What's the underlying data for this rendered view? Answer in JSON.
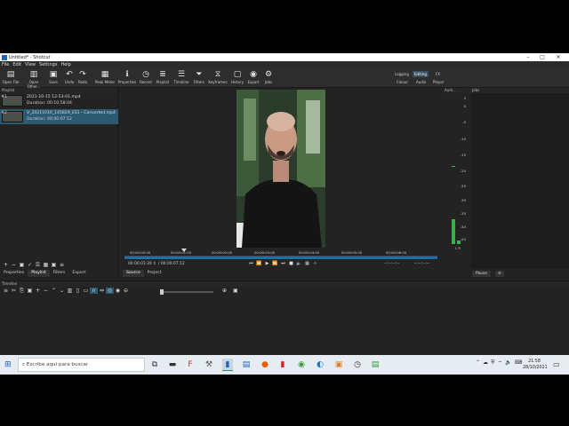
{
  "window": {
    "title": "Untitled* - Shotcut",
    "minimize": "–",
    "maximize": "□",
    "close": "✕"
  },
  "menu": [
    "File",
    "Edit",
    "View",
    "Settings",
    "Help"
  ],
  "toolbar": {
    "open_file": "Open File",
    "open_other": "Open Other...",
    "save": "Save",
    "undo": "Undo",
    "redo": "Redo",
    "peak_meter": "Peak Meter",
    "properties": "Properties",
    "recent": "Recent",
    "playlist": "Playlist",
    "timeline": "Timeline",
    "filters": "Filters",
    "keyframes": "Keyframes",
    "history": "History",
    "export": "Export",
    "jobs": "Jobs"
  },
  "layouts": {
    "logging": "Logging",
    "editing": "Editing",
    "fx": "FX",
    "colour": "Colour",
    "audio": "Audio",
    "player": "Player"
  },
  "playlist": {
    "title": "Playlist",
    "items": [
      {
        "number": "#1",
        "name": "2021-10-15 12-53-01.mp4",
        "duration": "Duration: 00:10:58:04"
      },
      {
        "number": "#2",
        "name": "V_20211010_145829_ES1 - Converted.mp4",
        "duration": "Duration: 00:00:07:12"
      }
    ],
    "tabs": [
      "Properties",
      "Playlist",
      "Filters",
      "Export"
    ]
  },
  "viewer": {
    "ruler_ticks": [
      "00:00:00:00",
      "00:00:01:00",
      "00:00:02:00",
      "00:00:03:00",
      "00:00:04:00",
      "00:00:05:00",
      "00:00:06:00"
    ],
    "current_time": "00:00:01:20",
    "total_time": "/ 00:00:07:12",
    "in_point": "--:--:--:--",
    "out_point": "--:--:--:--",
    "tabs": [
      "Source",
      "Project"
    ],
    "playhead_fraction": 0.19
  },
  "audio_meter": {
    "title": "Audi...",
    "labels": [
      "3",
      "0",
      "-5",
      "-10",
      "-15",
      "-20",
      "-25",
      "-30",
      "-35",
      "-40",
      "-50"
    ],
    "channels": "L R",
    "left_level_db": -42,
    "right_level_db": -50
  },
  "jobs": {
    "title": "Jobs",
    "pause_label": "Pause",
    "menu_icon": "≡"
  },
  "timeline": {
    "title": "Timeline"
  },
  "taskbar": {
    "search_placeholder": "Escribe aquí para buscar",
    "time": "21:58",
    "date": "28/10/2021"
  }
}
